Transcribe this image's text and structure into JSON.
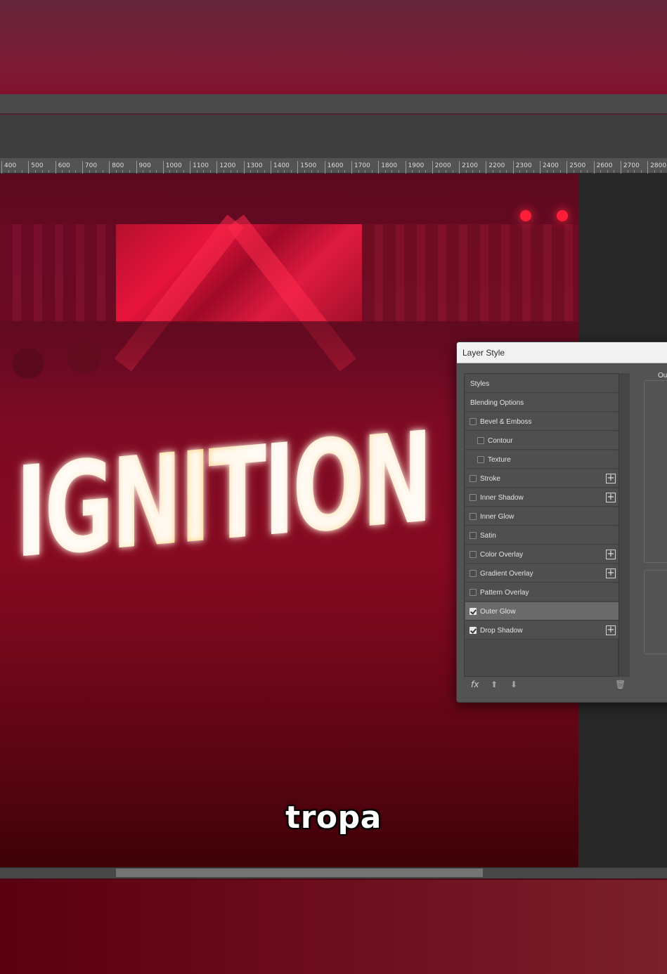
{
  "ruler": {
    "ticks": [
      "400",
      "500",
      "600",
      "700",
      "800",
      "900",
      "1000",
      "1100",
      "1200",
      "1300",
      "1400",
      "1500",
      "1600",
      "1700",
      "1800",
      "1900",
      "2000",
      "2100",
      "2200",
      "2300",
      "2400",
      "2500",
      "2600",
      "2700",
      "2800"
    ]
  },
  "canvas": {
    "artwork_title": "IGNITION"
  },
  "dialog": {
    "title": "Layer Style",
    "styles_header": "Styles",
    "blending_options": "Blending Options",
    "items": [
      {
        "label": "Bevel & Emboss",
        "checked": false,
        "plus": false
      },
      {
        "label": "Contour",
        "checked": false,
        "plus": false
      },
      {
        "label": "Texture",
        "checked": false,
        "plus": false
      },
      {
        "label": "Stroke",
        "checked": false,
        "plus": true
      },
      {
        "label": "Inner Shadow",
        "checked": false,
        "plus": true
      },
      {
        "label": "Inner Glow",
        "checked": false,
        "plus": false
      },
      {
        "label": "Satin",
        "checked": false,
        "plus": false
      },
      {
        "label": "Color Overlay",
        "checked": false,
        "plus": true
      },
      {
        "label": "Gradient Overlay",
        "checked": false,
        "plus": true
      },
      {
        "label": "Pattern Overlay",
        "checked": false,
        "plus": false
      },
      {
        "label": "Outer Glow",
        "checked": true,
        "plus": false
      },
      {
        "label": "Drop Shadow",
        "checked": true,
        "plus": true
      }
    ],
    "selected_item": "Outer Glow",
    "right_pane_heading": "Ou",
    "footer_icons": [
      "fx-icon",
      "arrow-up-icon",
      "arrow-down-icon",
      "trash-icon"
    ]
  },
  "caption": "tropa"
}
